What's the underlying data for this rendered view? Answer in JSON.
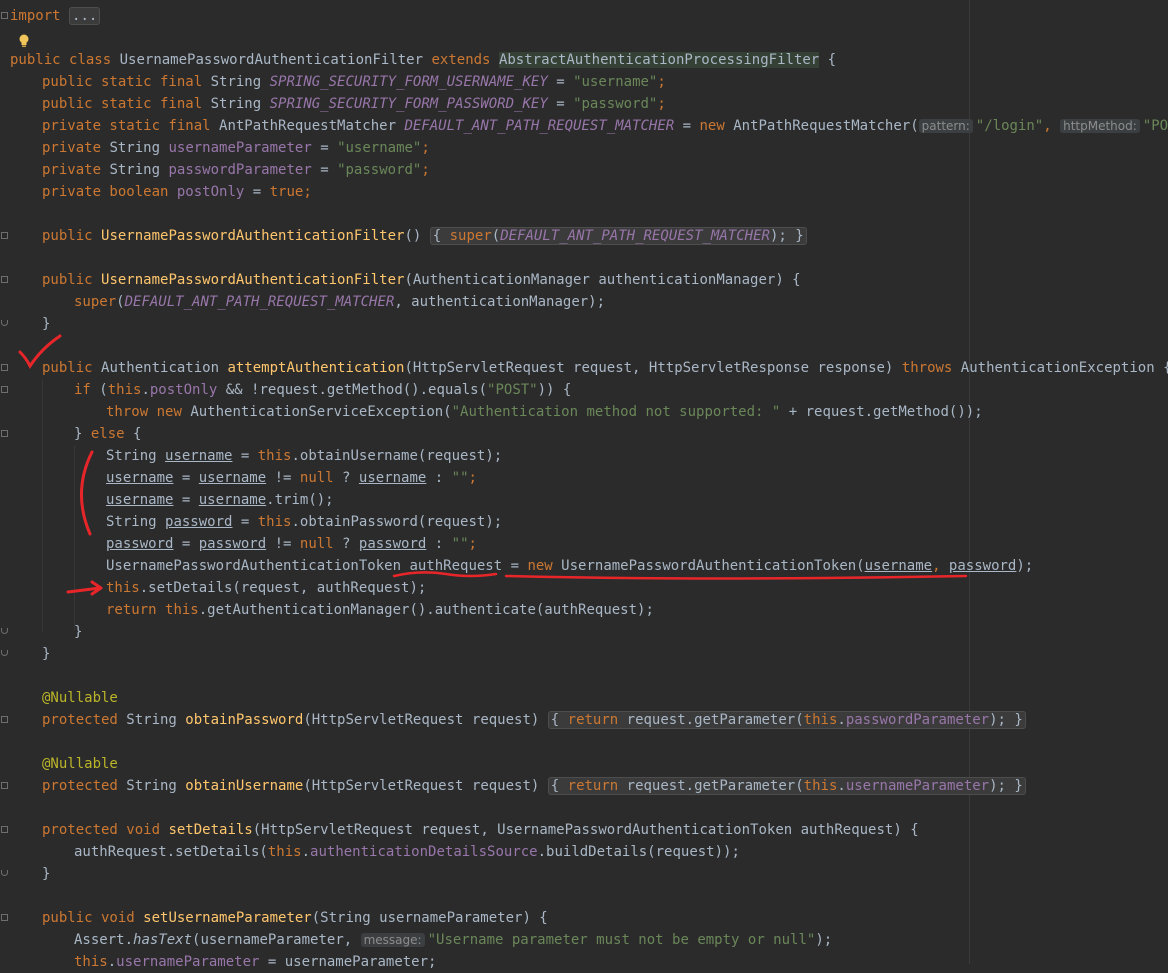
{
  "editor": {
    "colors": {
      "background": "#2b2b2b",
      "keyword": "#cc7832",
      "string": "#6a8759",
      "method": "#ffc66d",
      "constant": "#9876aa",
      "annotation": "#bbb529",
      "text": "#a9b7c6",
      "annotation_marks": "#e8262a"
    },
    "lines": {
      "l1": {
        "kw": "import",
        "fold": "..."
      },
      "l3": {
        "kw1": "public",
        "kw2": "class",
        "name": "UsernamePasswordAuthenticationFilter",
        "kw3": "extends",
        "parent": "AbstractAuthenticationProcessingFilter",
        "brace": " {"
      },
      "l4": {
        "mods": "public static final",
        "type": "String",
        "const": "SPRING_SECURITY_FORM_USERNAME_KEY",
        "eq": " = ",
        "val": "\"username\"",
        "semi": ";"
      },
      "l5": {
        "mods": "public static final",
        "type": "String",
        "const": "SPRING_SECURITY_FORM_PASSWORD_KEY",
        "eq": " = ",
        "val": "\"password\"",
        "semi": ";"
      },
      "l6": {
        "mods": "private static final",
        "type": "AntPathRequestMatcher",
        "const": "DEFAULT_ANT_PATH_REQUEST_MATCHER",
        "eq": " = ",
        "kw": "new",
        "ctor": " AntPathRequestMatcher(",
        "hint1": "pattern:",
        "val1": "\"/login\"",
        "comma": ", ",
        "hint2": "httpMethod:",
        "val2": "\"POST\"",
        "end": ");"
      },
      "l7": {
        "mods": "private",
        "type": "String",
        "field": "usernameParameter",
        "eq": " = ",
        "val": "\"username\"",
        "semi": ";"
      },
      "l8": {
        "mods": "private",
        "type": "String",
        "field": "passwordParameter",
        "eq": " = ",
        "val": "\"password\"",
        "semi": ";"
      },
      "l9": {
        "mods": "private boolean",
        "field": "postOnly",
        "eq": " = ",
        "val": "true",
        "semi": ";"
      },
      "l11": {
        "mods": "public",
        "fn": "UsernamePasswordAuthenticationFilter",
        "paren": "()",
        "open": "{",
        "kw": "super",
        "arg": "DEFAULT_ANT_PATH_REQUEST_MATCHER",
        "end": ");",
        "close": "}"
      },
      "l13": {
        "mods": "public",
        "fn": "UsernamePasswordAuthenticationFilter",
        "params": "(AuthenticationManager authenticationManager) {"
      },
      "l14": {
        "kw": "super",
        "open": "(",
        "arg": "DEFAULT_ANT_PATH_REQUEST_MATCHER",
        "rest": ", authenticationManager);"
      },
      "l15": {
        "text": "}"
      },
      "l17": {
        "mods": "public",
        "type": "Authentication",
        "fn": "attemptAuthentication",
        "params": "(HttpServletRequest request, HttpServletResponse response) ",
        "kw": "throws",
        "ex": " AuthenticationException {"
      },
      "l18": {
        "kw": "if",
        "p1": " (",
        "kw2": "this",
        "dot": ".",
        "field": "postOnly",
        "rest": " && !request.getMethod().equals(",
        "val": "\"POST\"",
        "end": ")) {"
      },
      "l19": {
        "kw": "throw",
        "kw2": "new",
        "ex": " AuthenticationServiceException(",
        "val": "\"Authentication method not supported: \"",
        "rest": " + request.getMethod());"
      },
      "l20": {
        "text": "} ",
        "kw": "else",
        "brace": " {"
      },
      "l21": {
        "type": "String ",
        "var": "username",
        "eq": " = ",
        "kw": "this",
        "rest": ".obtainUsername(request);"
      },
      "l22": {
        "var": "username",
        "eq": " = ",
        "var2": "username",
        "op": " != ",
        "kw": "null",
        "q": " ? ",
        "var3": "username",
        "c": " : ",
        "val": "\"\"",
        "semi": ";"
      },
      "l23": {
        "var": "username",
        "eq": " = ",
        "var2": "username",
        "rest": ".trim();"
      },
      "l24": {
        "type": "String ",
        "var": "password",
        "eq": " = ",
        "kw": "this",
        "rest": ".obtainPassword(request);"
      },
      "l25": {
        "var": "password",
        "eq": " = ",
        "var2": "password",
        "op": " != ",
        "kw": "null",
        "q": " ? ",
        "var3": "password",
        "c": " : ",
        "val": "\"\"",
        "semi": ";"
      },
      "l26": {
        "type": "UsernamePasswordAuthenticationToken ",
        "var": "authRequest",
        "eq": " = ",
        "kw": "new",
        "ctor": " UsernamePasswordAuthenticationToken(",
        "a1": "username",
        "comma": ", ",
        "a2": "password",
        "end": ");"
      },
      "l27": {
        "kw": "this",
        "rest": ".setDetails(request, authRequest);"
      },
      "l28": {
        "kw": "return",
        "sp": " ",
        "kw2": "this",
        "rest": ".getAuthenticationManager().authenticate(authRequest);"
      },
      "l29": {
        "text": "}"
      },
      "l30": {
        "text": "}"
      },
      "l32": {
        "ann": "@Nullable"
      },
      "l33": {
        "mods": "protected",
        "type": " String ",
        "fn": "obtainPassword",
        "params": "(HttpServletRequest request)",
        "open": "{",
        "kw": "return",
        "rest": " request.getParameter(",
        "kw2": "this",
        "dot": ".",
        "field": "passwordParameter",
        "end": ");",
        "close": "}"
      },
      "l35": {
        "ann": "@Nullable"
      },
      "l36": {
        "mods": "protected",
        "type": " String ",
        "fn": "obtainUsername",
        "params": "(HttpServletRequest request)",
        "open": "{",
        "kw": "return",
        "rest": " request.getParameter(",
        "kw2": "this",
        "dot": ".",
        "field": "usernameParameter",
        "end": ");",
        "close": "}"
      },
      "l38": {
        "mods": "protected void",
        "fn": "setDetails",
        "params": "(HttpServletRequest request, UsernamePasswordAuthenticationToken authRequest) {"
      },
      "l39": {
        "pre": "authRequest.setDetails(",
        "kw": "this",
        "dot": ".",
        "field": "authenticationDetailsSource",
        "rest": ".buildDetails(request));"
      },
      "l40": {
        "text": "}"
      },
      "l42": {
        "mods": "public void",
        "fn": "setUsernameParameter",
        "params": "(String usernameParameter) {"
      },
      "l43": {
        "pre": "Assert.",
        "fn": "hasText",
        "mid": "(usernameParameter, ",
        "hint": "message:",
        "val": "\"Username parameter must not be empty or null\"",
        "end": ");"
      },
      "l44": {
        "kw": "this",
        "dot": ".",
        "field": "usernameParameter",
        "rest": " = usernameParameter;"
      }
    }
  }
}
